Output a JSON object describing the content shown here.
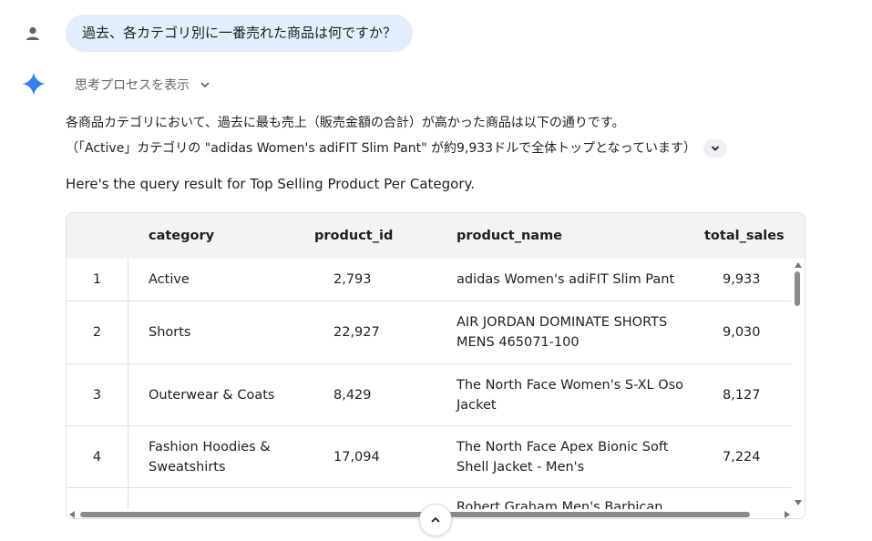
{
  "user": {
    "message": "過去、各カテゴリ別に一番売れた商品は何ですか？"
  },
  "assistant": {
    "thinking_label": "思考プロセスを表示",
    "answer_line1": "各商品カテゴリにおいて、過去に最も売上（販売金額の合計）が高かった商品は以下の通りです。",
    "answer_line2": "（「Active」カテゴリの \"adidas Women's adiFIT Slim Pant\" が約9,933ドルで全体トップとなっています）",
    "query_text": "Here's the query result for Top Selling Product Per Category."
  },
  "table": {
    "headers": {
      "category": "category",
      "product_id": "product_id",
      "product_name": "product_name",
      "total_sales": "total_sales"
    },
    "rows": [
      {
        "index": "1",
        "category": "Active",
        "product_id": "2,793",
        "product_name": "adidas Women's adiFIT Slim Pant",
        "total_sales": "9,933"
      },
      {
        "index": "2",
        "category": "Shorts",
        "product_id": "22,927",
        "product_name": "AIR JORDAN DOMINATE SHORTS MENS 465071-100",
        "total_sales": "9,030"
      },
      {
        "index": "3",
        "category": "Outerwear & Coats",
        "product_id": "8,429",
        "product_name": "The North Face Women's S-XL Oso Jacket",
        "total_sales": "8,127"
      },
      {
        "index": "4",
        "category": "Fashion Hoodies & Sweatshirts",
        "product_id": "17,094",
        "product_name": "The North Face Apex Bionic Soft Shell Jacket - Men's",
        "total_sales": "7,224"
      },
      {
        "index": "",
        "category": "",
        "product_id": "",
        "product_name": "Robert Graham Men's Barbican",
        "total_sales": ""
      }
    ]
  },
  "icons": {
    "user": "person-icon",
    "gemini": "sparkle-icon",
    "thinking_chevron": "chevron-down-icon",
    "expand": "chevron-down-icon",
    "scroll_top": "chevron-up-icon"
  },
  "colors": {
    "bubble": "#e3edfb",
    "accent": "#4285f4",
    "header_bg": "#f1f3f5"
  }
}
